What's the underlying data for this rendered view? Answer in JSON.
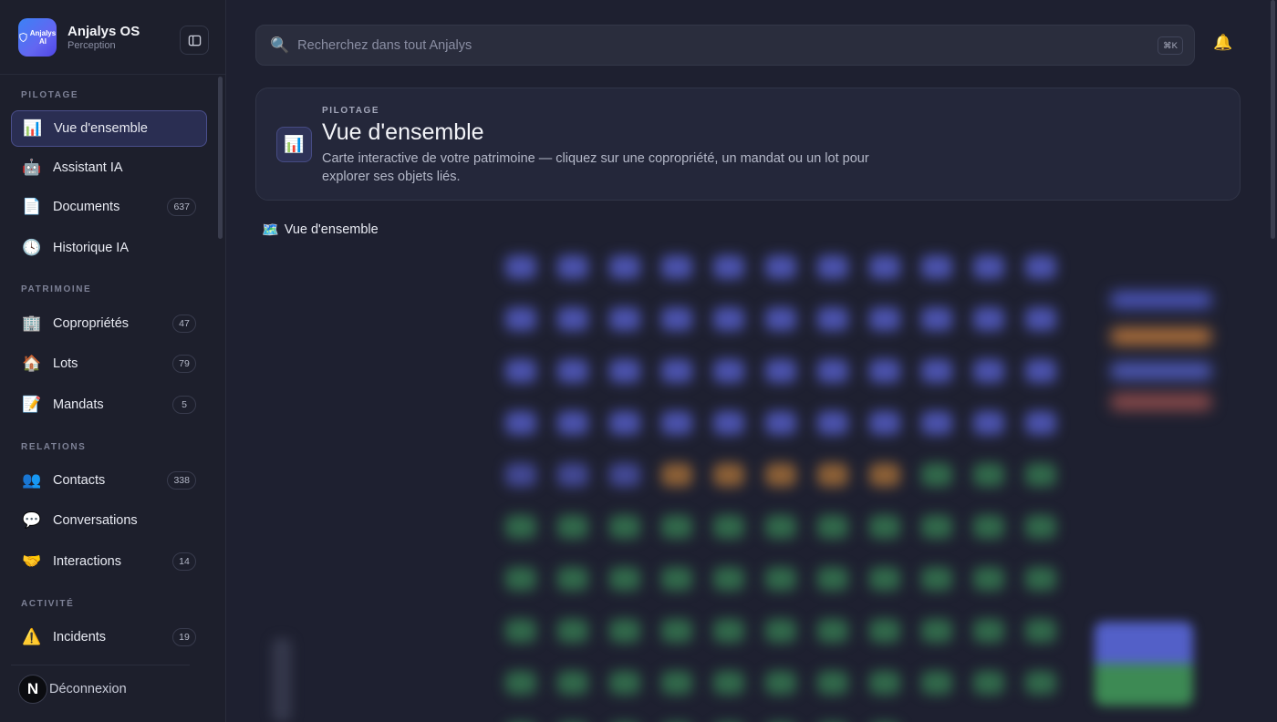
{
  "brand": {
    "name": "Anjalys OS",
    "subtitle": "Perception",
    "logo_text": "Anjalys AI"
  },
  "sidebar": {
    "sections": [
      {
        "label": "PILOTAGE"
      },
      {
        "label": "PATRIMOINE"
      },
      {
        "label": "RELATIONS"
      },
      {
        "label": "ACTIVITÉ"
      }
    ],
    "items": [
      {
        "label": "Vue d'ensemble",
        "icon": "bar-chart-icon",
        "glyph": "📊",
        "badge": null,
        "active": true
      },
      {
        "label": "Assistant IA",
        "icon": "robot-icon",
        "glyph": "🤖",
        "badge": null
      },
      {
        "label": "Documents",
        "icon": "document-icon",
        "glyph": "📄",
        "badge": "637"
      },
      {
        "label": "Historique IA",
        "icon": "clock-icon",
        "glyph": "🕓",
        "badge": null
      },
      {
        "label": "Copropriétés",
        "icon": "building-icon",
        "glyph": "🏢",
        "badge": "47"
      },
      {
        "label": "Lots",
        "icon": "house-icon",
        "glyph": "🏠",
        "badge": "79"
      },
      {
        "label": "Mandats",
        "icon": "contract-icon",
        "glyph": "📝",
        "badge": "5"
      },
      {
        "label": "Contacts",
        "icon": "people-icon",
        "glyph": "👥",
        "badge": "338"
      },
      {
        "label": "Conversations",
        "icon": "speech-bubble-icon",
        "glyph": "💬",
        "badge": null
      },
      {
        "label": "Interactions",
        "icon": "handshake-icon",
        "glyph": "🤝",
        "badge": "14"
      },
      {
        "label": "Incidents",
        "icon": "warning-icon",
        "glyph": "⚠️",
        "badge": "19"
      }
    ],
    "logout_label": "Déconnexion",
    "avatar_letter": "N"
  },
  "search": {
    "placeholder": "Recherchez dans tout Anjalys",
    "shortcut": "⌘K"
  },
  "header": {
    "eyebrow": "PILOTAGE",
    "title": "Vue d'ensemble",
    "description": "Carte interactive de votre patrimoine — cliquez sur une copropriété, un mandat ou un lot pour explorer ses objets liés.",
    "icon_glyph": "📊"
  },
  "map_section": {
    "title": "Vue d'ensemble",
    "icon_glyph": "🗺️"
  },
  "colors": {
    "accent": "#4a4f8c",
    "node_blue": "#5a63d6",
    "node_orange": "#d68a3a",
    "node_green": "#3e9a5c",
    "background": "#1e2030"
  }
}
